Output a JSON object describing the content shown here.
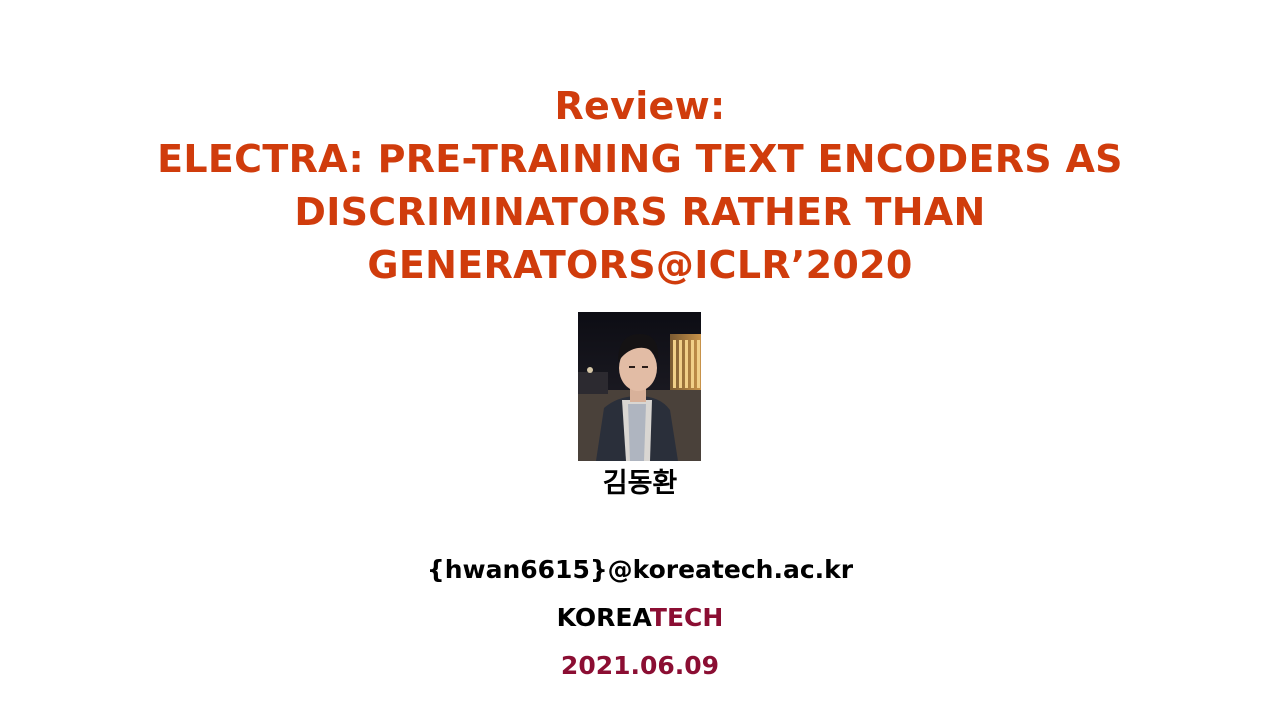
{
  "title": {
    "line1": "Review:",
    "line2": "ELECTRA: PRE-TRAINING TEXT ENCODERS AS",
    "line3": "DISCRIMINATORS RATHER THAN",
    "line4": "GENERATORS@ICLR’2020"
  },
  "author": {
    "name": "김동환",
    "email": "{hwan6615}@koreatech.ac.kr"
  },
  "affiliation": {
    "part1": "KOREA",
    "part2": "TECH"
  },
  "date": "2021.06.09",
  "colors": {
    "title": "#d03c0c",
    "text": "#000000",
    "accent": "#8b0e33"
  }
}
